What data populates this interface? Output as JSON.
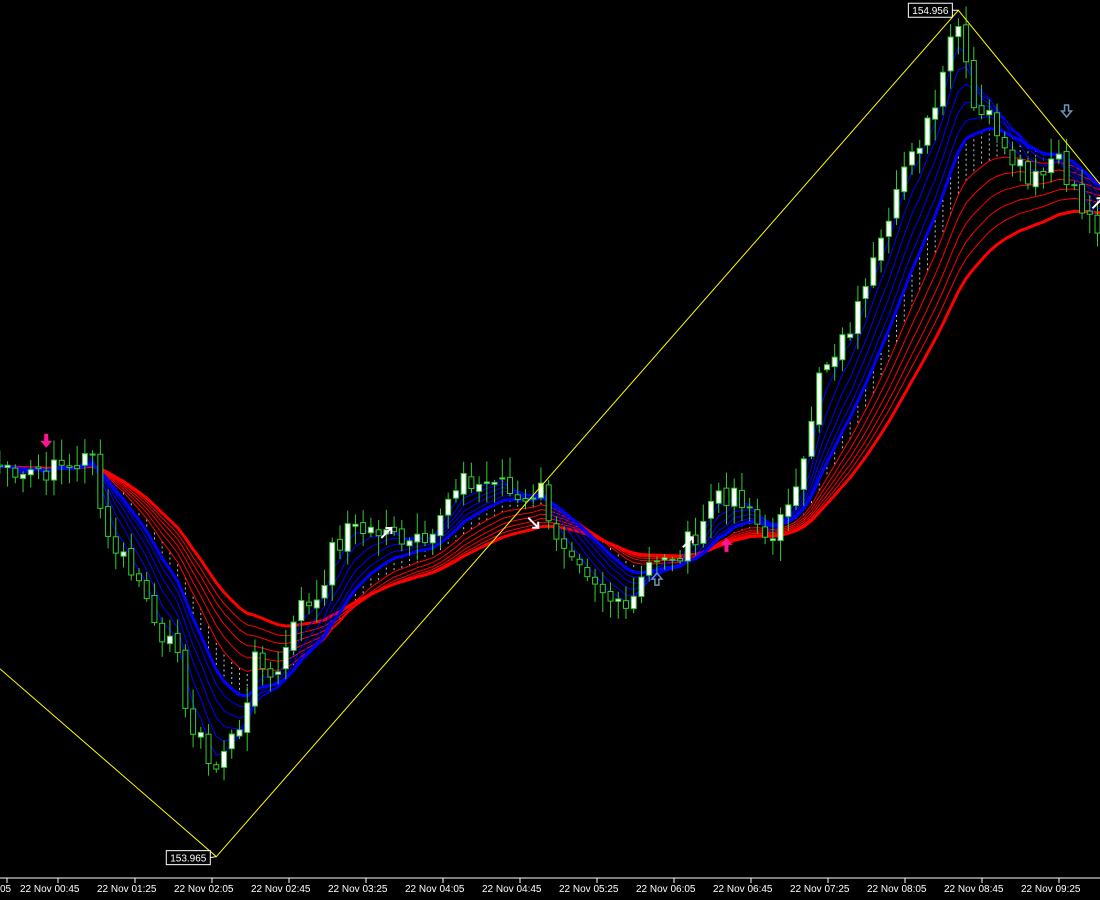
{
  "chart_data": {
    "type": "candlestick",
    "interval_minutes": 5,
    "x_ticks": [
      "05",
      "22 Nov 00:45",
      "22 Nov 01:25",
      "22 Nov 02:05",
      "22 Nov 02:45",
      "22 Nov 03:25",
      "22 Nov 04:05",
      "22 Nov 04:45",
      "22 Nov 05:25",
      "22 Nov 06:05",
      "22 Nov 06:45",
      "22 Nov 07:25",
      "22 Nov 08:05",
      "22 Nov 08:45",
      "22 Nov 09:25"
    ],
    "y_range": [
      153.94,
      154.968
    ],
    "price_labels": [
      {
        "name": "swing-high",
        "text": "154.956",
        "value": 154.956,
        "tick": 119
      },
      {
        "name": "swing-low",
        "text": "153.965",
        "value": 153.965,
        "tick": 23
      }
    ],
    "zigzag": [
      {
        "tick": -5,
        "value": 154.185
      },
      {
        "tick": 23,
        "value": 153.965
      },
      {
        "tick": 119,
        "value": 154.956
      },
      {
        "tick": 138,
        "value": 154.745
      }
    ],
    "price_path": [
      [
        -5,
        154.422
      ],
      [
        2,
        154.418
      ],
      [
        7,
        154.431
      ],
      [
        9,
        154.34
      ],
      [
        12,
        154.305
      ],
      [
        16,
        154.23
      ],
      [
        18,
        154.19
      ],
      [
        20,
        154.11
      ],
      [
        23,
        154.07
      ],
      [
        26,
        154.12
      ],
      [
        28,
        154.19
      ],
      [
        31,
        154.18
      ],
      [
        33,
        154.25
      ],
      [
        36,
        154.27
      ],
      [
        38,
        154.32
      ],
      [
        41,
        154.355
      ],
      [
        45,
        154.34
      ],
      [
        50,
        154.345
      ],
      [
        55,
        154.4
      ],
      [
        59,
        154.405
      ],
      [
        62,
        154.385
      ],
      [
        65,
        154.395
      ],
      [
        68,
        154.318
      ],
      [
        71,
        154.28
      ],
      [
        74,
        154.26
      ],
      [
        77,
        154.275
      ],
      [
        79,
        154.318
      ],
      [
        82,
        154.305
      ],
      [
        85,
        154.345
      ],
      [
        88,
        154.395
      ],
      [
        91,
        154.375
      ],
      [
        94,
        154.34
      ],
      [
        97,
        154.365
      ],
      [
        101,
        154.525
      ],
      [
        103,
        154.545
      ],
      [
        106,
        154.605
      ],
      [
        108,
        154.68
      ],
      [
        111,
        154.745
      ],
      [
        113,
        154.78
      ],
      [
        116,
        154.855
      ],
      [
        118,
        154.925
      ],
      [
        119,
        154.95
      ],
      [
        121,
        154.85
      ],
      [
        124,
        154.82
      ],
      [
        126,
        154.79
      ],
      [
        128,
        154.765
      ],
      [
        130,
        154.775
      ],
      [
        132,
        154.79
      ],
      [
        135,
        154.72
      ],
      [
        137,
        154.7
      ],
      [
        138,
        154.71
      ]
    ],
    "ribbon_blue": {
      "count": 6,
      "spread": 0.012
    },
    "ribbon_red": {
      "count": 6,
      "spread": 0.009
    },
    "colors": {
      "background": "#000000",
      "bull_candle": "#ffffff",
      "bear_candle": "#000000",
      "candle_outline": "#32cd32",
      "ma_fast": "#0000ff",
      "ma_slow": "#ff0000",
      "zigzag": "#ffff00",
      "signal_pink": "#ff1493",
      "signal_white": "#ffffff",
      "signal_steel": "#6f94b4",
      "axis_text": "#ffffff"
    },
    "signals": [
      {
        "name": "arrow-down-pink",
        "type": "down-big",
        "color": "#ff1493",
        "tick": 1,
        "value": 154.452
      },
      {
        "name": "arrow-ne-white",
        "type": "ne",
        "color": "#ffffff",
        "tick": 45,
        "value": 154.344
      },
      {
        "name": "arrow-se-white",
        "type": "se",
        "color": "#ffffff",
        "tick": 64,
        "value": 154.356
      },
      {
        "name": "arrow-up-hollow",
        "type": "up-hollow",
        "color": "#6f94b4",
        "tick": 80,
        "value": 154.29
      },
      {
        "name": "arrow-ne-white-2",
        "type": "ne",
        "color": "#ffffff",
        "tick": 84,
        "value": 154.333
      },
      {
        "name": "arrow-up-pink",
        "type": "up-big",
        "color": "#ff1493",
        "tick": 89,
        "value": 154.33
      },
      {
        "name": "arrow-down-hollow",
        "type": "down-hollow",
        "color": "#6f94b4",
        "tick": 133,
        "value": 154.838
      },
      {
        "name": "arrow-ne-white-3",
        "type": "ne",
        "color": "#ffffff",
        "tick": 137,
        "value": 154.73
      }
    ]
  }
}
